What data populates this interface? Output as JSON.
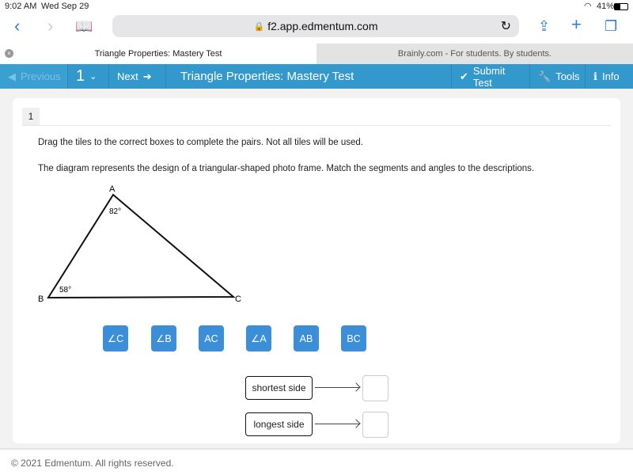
{
  "status": {
    "time": "9:02 AM",
    "date": "Wed Sep 29",
    "battery": "41%"
  },
  "browser": {
    "url": "f2.app.edmentum.com"
  },
  "tabs": [
    {
      "label": "Triangle Properties: Mastery Test",
      "active": true
    },
    {
      "label": "Brainly.com - For students. By students.",
      "active": false
    }
  ],
  "nav": {
    "previous": "Previous",
    "question_number": "1",
    "next": "Next",
    "title": "Triangle Properties: Mastery Test",
    "submit": "Submit Test",
    "tools": "Tools",
    "info": "Info",
    "color": "#3399cc"
  },
  "question": {
    "number": "1",
    "instruction": "Drag the tiles to the correct boxes to complete the pairs. Not all tiles will be used.",
    "prompt": "The diagram represents the design of a triangular-shaped photo frame. Match the segments and angles to the descriptions.",
    "diagram": {
      "vertices": [
        "A",
        "B",
        "C"
      ],
      "angle_A": "82°",
      "angle_B": "58°"
    },
    "tiles": [
      "∠C",
      "∠B",
      "AC",
      "∠A",
      "AB",
      "BC"
    ],
    "pairs": [
      {
        "label": "shortest side",
        "answer": ""
      },
      {
        "label": "longest side",
        "answer": ""
      }
    ]
  },
  "footer": "© 2021 Edmentum. All rights reserved."
}
